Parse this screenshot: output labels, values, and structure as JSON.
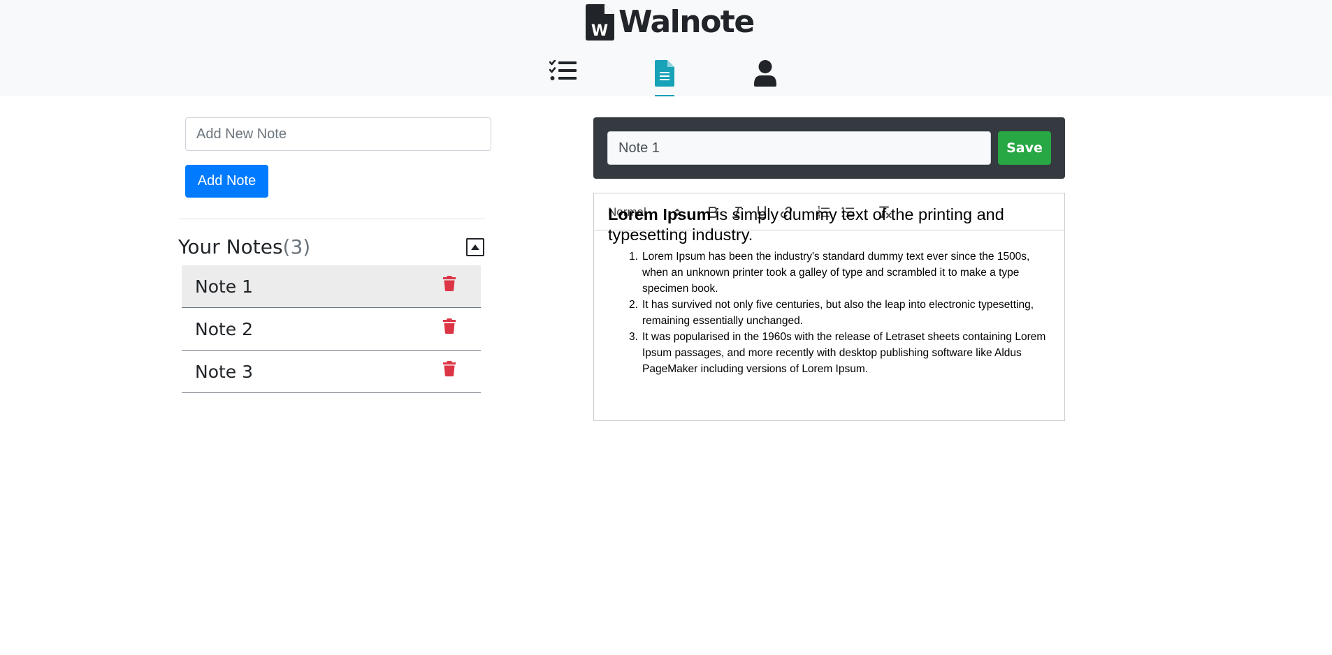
{
  "brand": {
    "name": "Walnote",
    "logo_letter": "W"
  },
  "nav": {
    "items": [
      {
        "name": "tasks",
        "icon": "tasks-list-icon",
        "active": false
      },
      {
        "name": "notes",
        "icon": "file-alt-icon",
        "active": true
      },
      {
        "name": "profile",
        "icon": "user-icon",
        "active": false
      }
    ],
    "active_color": "#17a2b8"
  },
  "new_note": {
    "placeholder": "Add New Note",
    "value": "",
    "button_label": "Add Note"
  },
  "notes_panel": {
    "heading": "Your Notes",
    "count": "(3)",
    "collapse_icon": "caret-square-up-icon",
    "notes": [
      {
        "title": "Note 1",
        "selected": true
      },
      {
        "title": "Note 2",
        "selected": false
      },
      {
        "title": "Note 3",
        "selected": false
      }
    ],
    "delete_icon": "trash-icon",
    "delete_color": "#dc3545"
  },
  "editor": {
    "title_value": "Note 1",
    "save_label": "Save",
    "toolbar": {
      "header_select": "Normal",
      "buttons": [
        "bold-icon",
        "italic-icon",
        "underline-icon",
        "link-icon",
        "ordered-list-icon",
        "bullet-list-icon",
        "clear-format-icon"
      ]
    },
    "content": {
      "lead_bold": "Lorem Ipsum",
      "lead_rest": " is simply dummy text of the printing and typesetting industry.",
      "list": [
        {
          "num": "1.",
          "text": " Lorem Ipsum has been the industry's standard dummy text ever since the 1500s, when an unknown printer took a galley of type and scrambled it to make a type specimen book."
        },
        {
          "num": "2.",
          "text": " It has survived not only five centuries, but also the leap into electronic typesetting, remaining essentially unchanged."
        },
        {
          "num": "3.",
          "text": "It was popularised in the 1960s with the release of Letraset sheets containing Lorem Ipsum passages, and more recently with desktop publishing software like Aldus PageMaker including versions of Lorem Ipsum."
        }
      ]
    }
  },
  "colors": {
    "primary": "#007bff",
    "success": "#28a745",
    "dark": "#343a40",
    "light": "#f8f9fa",
    "danger": "#dc3545",
    "info": "#17a2b8"
  }
}
